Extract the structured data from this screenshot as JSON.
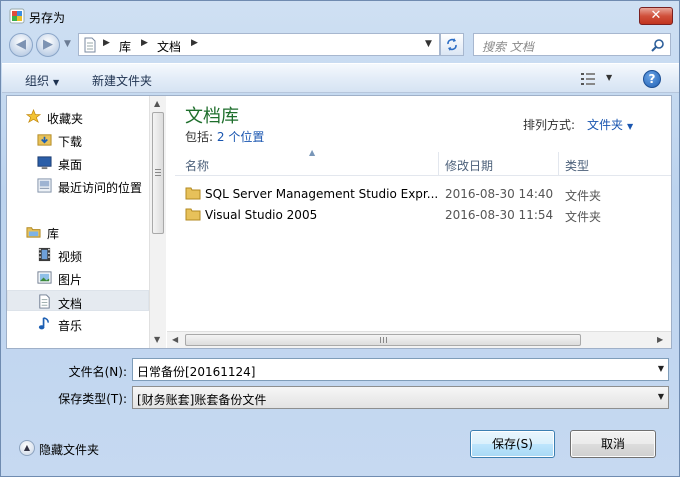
{
  "window": {
    "title": "另存为",
    "close_glyph": "✕"
  },
  "address": {
    "crumbs": [
      "库",
      "文档"
    ],
    "search_placeholder": "搜索 文档"
  },
  "toolbar": {
    "organize": "组织",
    "new_folder": "新建文件夹",
    "help_glyph": "?"
  },
  "nav": {
    "items": [
      {
        "label": "收藏夹",
        "icon": "star-icon"
      },
      {
        "label": "下载",
        "icon": "download-folder-icon"
      },
      {
        "label": "桌面",
        "icon": "desktop-icon"
      },
      {
        "label": "最近访问的位置",
        "icon": "recent-places-icon"
      },
      {
        "label": "库",
        "icon": "library-icon"
      },
      {
        "label": "视频",
        "icon": "video-icon"
      },
      {
        "label": "图片",
        "icon": "pictures-icon"
      },
      {
        "label": "文档",
        "icon": "documents-icon",
        "selected": true
      },
      {
        "label": "音乐",
        "icon": "music-icon"
      }
    ]
  },
  "library": {
    "title": "文档库",
    "includes_label": "包括:",
    "includes_link": "2 个位置",
    "arrange_label": "排列方式:",
    "arrange_value": "文件夹"
  },
  "columns": {
    "name": "名称",
    "date": "修改日期",
    "type": "类型"
  },
  "files": [
    {
      "name": "SQL Server Management Studio Expr...",
      "date": "2016-08-30 14:40",
      "type": "文件夹"
    },
    {
      "name": "Visual Studio 2005",
      "date": "2016-08-30 11:54",
      "type": "文件夹"
    }
  ],
  "form": {
    "filename_label": "文件名(N):",
    "filename_value": "日常备份[20161124]",
    "filetype_label": "保存类型(T):",
    "filetype_value": "[财务账套]账套备份文件"
  },
  "footer": {
    "hide_folders": "隐藏文件夹",
    "save": "保存(S)",
    "cancel": "取消"
  },
  "colors": {
    "library_title": "#1e6e2c",
    "link": "#1a56b0",
    "close_button": "#c1341f"
  }
}
